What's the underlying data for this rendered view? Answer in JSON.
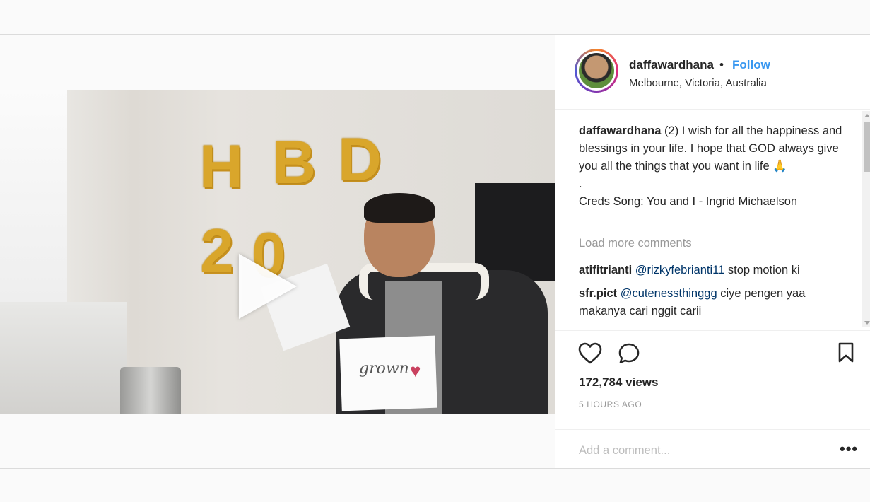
{
  "post": {
    "author": {
      "username": "daffawardhana",
      "separator": "•",
      "follow_label": "Follow",
      "location": "Melbourne, Victoria, Australia"
    },
    "video": {
      "balloon_letters": [
        "H",
        "B",
        "D",
        "2",
        "0"
      ],
      "sign_text": "grown"
    },
    "caption": {
      "username": "daffawardhana",
      "text": "(2) I wish for all the happiness and blessings in your life. I hope that GOD always give you all the things that you want in life 🙏",
      "dot_line": ".",
      "creds": "Creds Song: You and I - Ingrid Michaelson"
    },
    "load_more_label": "Load more comments",
    "comments": [
      {
        "username": "atifitrianti",
        "mention": "@rizkyfebrianti11",
        "text": "stop motion ki"
      },
      {
        "username": "sfr.pict",
        "mention": "@cutenessthinggg",
        "text": "ciye pengen yaa makanya cari nggit carii"
      }
    ],
    "actions": {
      "like_icon": "heart-icon",
      "comment_icon": "comment-icon",
      "save_icon": "bookmark-icon"
    },
    "views_label": "172,784 views",
    "time_label": "5 HOURS AGO",
    "add_comment_placeholder": "Add a comment...",
    "more_label": "•••"
  },
  "colors": {
    "follow": "#3897f0",
    "mention": "#003569",
    "muted": "#999999"
  }
}
